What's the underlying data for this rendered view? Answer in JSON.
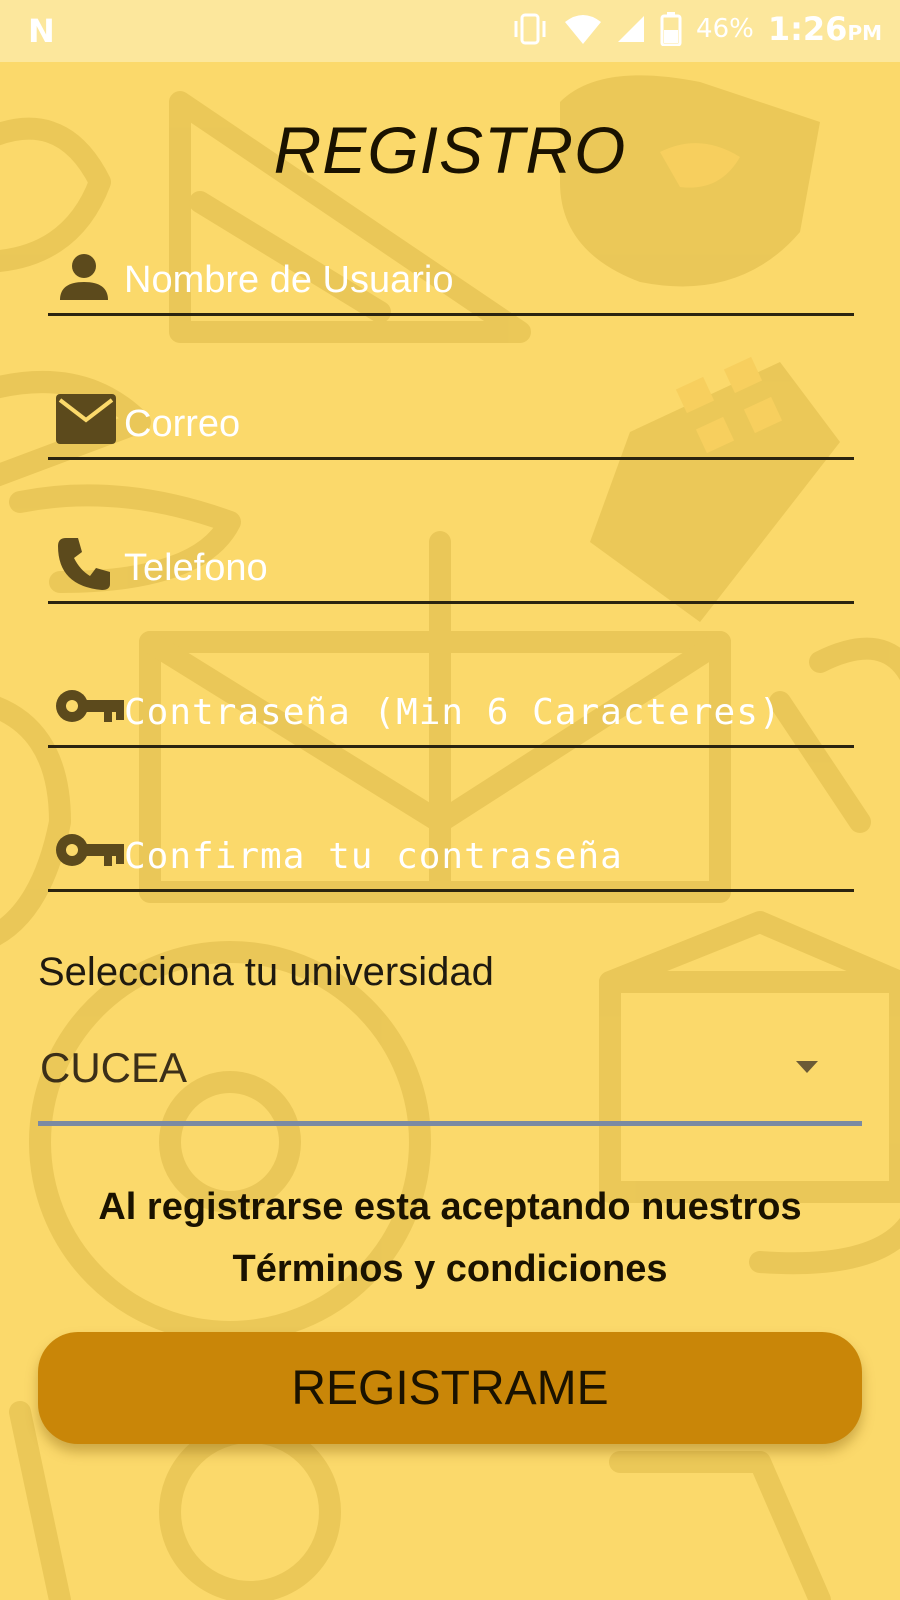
{
  "status_bar": {
    "left_glyph": "N",
    "battery_percent": "46%",
    "time": "1:26",
    "time_suffix": "PM",
    "icons": [
      "vibrate-icon",
      "wifi-icon",
      "signal-icon",
      "battery-icon"
    ]
  },
  "title": "REGISTRO",
  "form": {
    "username": {
      "placeholder": "Nombre de Usuario",
      "icon": "person-icon"
    },
    "email": {
      "placeholder": "Correo",
      "icon": "mail-icon"
    },
    "phone": {
      "placeholder": "Telefono",
      "icon": "phone-icon"
    },
    "password": {
      "placeholder": "Contraseña (Min 6 Caracteres)",
      "icon": "key-icon"
    },
    "confirm_password": {
      "placeholder": "Confirma tu contraseña",
      "icon": "key-icon"
    }
  },
  "university": {
    "label": "Selecciona tu universidad",
    "selected": "CUCEA"
  },
  "terms": {
    "line1": "Al registrarse esta aceptando nuestros",
    "line2": "Términos y condiciones"
  },
  "register_button": "REGISTRAME",
  "colors": {
    "background": "#fbd96b",
    "status_bar": "#fce79c",
    "button": "#c98608",
    "underline": "#2b2410",
    "select_underline": "#7a8aa2"
  }
}
